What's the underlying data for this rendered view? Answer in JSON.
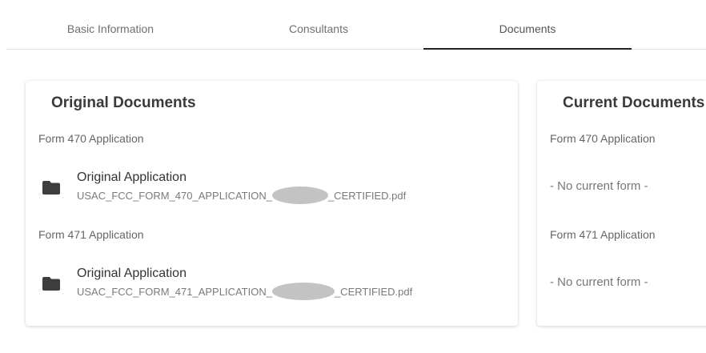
{
  "tabs": [
    {
      "label": "Basic Information",
      "active": false
    },
    {
      "label": "Consultants",
      "active": false
    },
    {
      "label": "Documents",
      "active": true
    }
  ],
  "original": {
    "title": "Original Documents",
    "sections": [
      {
        "label": "Form 470 Application",
        "doc_title": "Original Application",
        "file_prefix": "USAC_FCC_FORM_470_APPLICATION_",
        "file_suffix": "_CERTIFIED.pdf"
      },
      {
        "label": "Form 471 Application",
        "doc_title": "Original Application",
        "file_prefix": "USAC_FCC_FORM_471_APPLICATION_",
        "file_suffix": "_CERTIFIED.pdf"
      }
    ]
  },
  "current": {
    "title": "Current Documents",
    "sections": [
      {
        "label": "Form 470 Application",
        "empty_text": "- No current form -"
      },
      {
        "label": "Form 471 Application",
        "empty_text": "- No current form -"
      }
    ]
  },
  "colors": {
    "active_tab_indicator": "#222222",
    "folder_icon": "#3d3d3d",
    "redaction": "#c3c3c3"
  },
  "icons": {
    "document_folder": "folder-icon"
  }
}
